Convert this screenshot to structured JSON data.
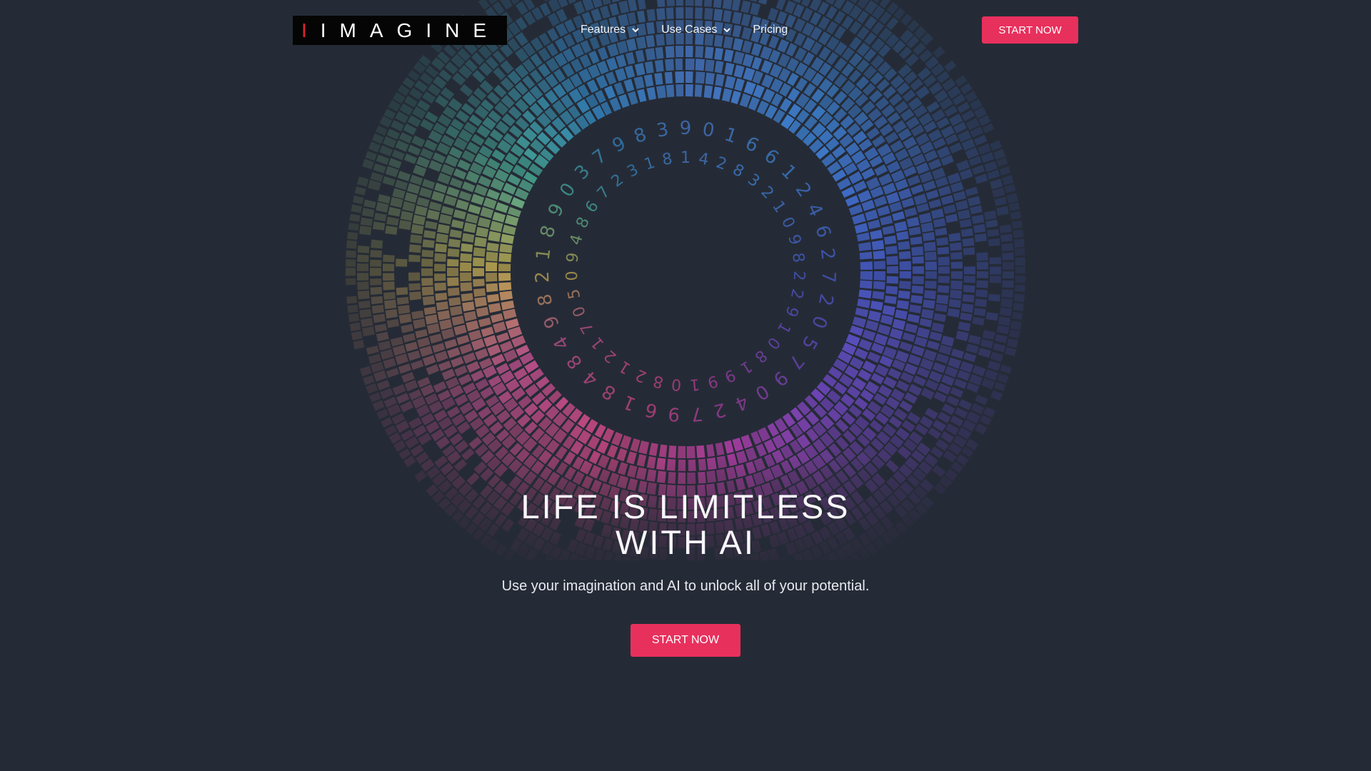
{
  "header": {
    "logo_accent": "I",
    "logo_text": "IMAGINE",
    "nav": {
      "features_label": "Features",
      "use_cases_label": "Use Cases",
      "pricing_label": "Pricing"
    },
    "cta_label": "START NOW"
  },
  "hero": {
    "headline_line1": "LIFE IS LIMITLESS",
    "headline_line2": "WITH AI",
    "subheadline": "Use your imagination and AI to unlock all of your potential.",
    "cta_label": "START NOW",
    "art_digits": [
      "9",
      "0",
      "1",
      "6",
      "6",
      "1",
      "2",
      "4",
      "6",
      "2",
      "7",
      "2",
      "0",
      "5",
      "7",
      "9",
      "0",
      "4",
      "2",
      "7",
      "9",
      "6",
      "1",
      "8",
      "4",
      "8",
      "4",
      "9",
      "8",
      "2",
      "1",
      "8",
      "9",
      "0",
      "3",
      "7",
      "9",
      "8",
      "3",
      "1",
      "4",
      "2",
      "8",
      "3",
      "2",
      "1",
      "0",
      "9",
      "8",
      "2",
      "2",
      "9",
      "1",
      "0",
      "8",
      "1",
      "9",
      "9",
      "1",
      "0",
      "8",
      "2",
      "1",
      "2",
      "1",
      "7",
      "0",
      "5",
      "0",
      "9",
      "4",
      "8",
      "6",
      "7",
      "2",
      "3",
      "1",
      "8"
    ]
  },
  "theme": {
    "background": "#252b36",
    "accent": "#e8305d",
    "logo_bg": "#050505",
    "logo_accent": "#e3232f"
  }
}
